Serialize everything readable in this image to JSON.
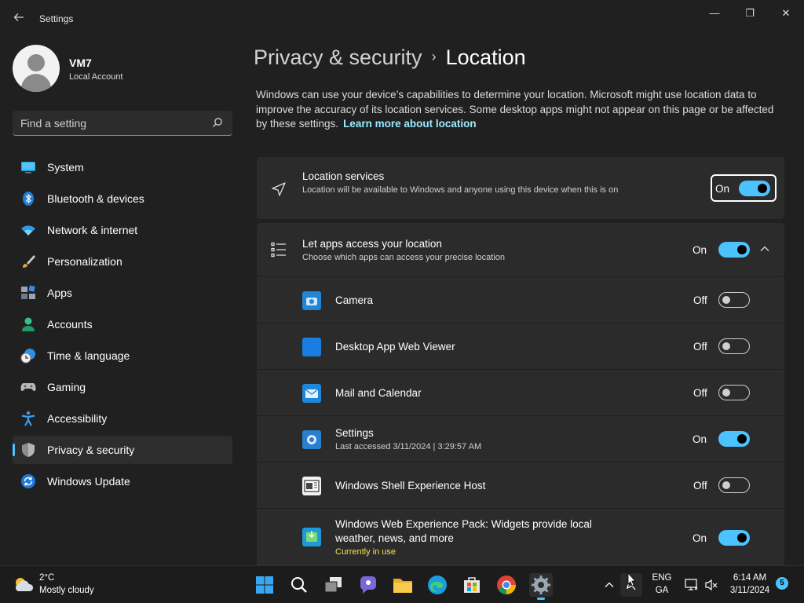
{
  "window": {
    "title": "Settings",
    "controls": {
      "minimize": "—",
      "maximize": "❐",
      "close": "✕"
    }
  },
  "profile": {
    "name": "VM7",
    "account_type": "Local Account"
  },
  "search": {
    "placeholder": "Find a setting"
  },
  "sidebar": {
    "items": [
      {
        "label": "System",
        "icon": "system-icon"
      },
      {
        "label": "Bluetooth & devices",
        "icon": "bluetooth-icon"
      },
      {
        "label": "Network & internet",
        "icon": "wifi-icon"
      },
      {
        "label": "Personalization",
        "icon": "brush-icon"
      },
      {
        "label": "Apps",
        "icon": "apps-icon"
      },
      {
        "label": "Accounts",
        "icon": "accounts-icon"
      },
      {
        "label": "Time & language",
        "icon": "clock-globe-icon"
      },
      {
        "label": "Gaming",
        "icon": "gamepad-icon"
      },
      {
        "label": "Accessibility",
        "icon": "accessibility-icon"
      },
      {
        "label": "Privacy & security",
        "icon": "shield-icon",
        "active": true
      },
      {
        "label": "Windows Update",
        "icon": "update-icon"
      }
    ]
  },
  "breadcrumb": {
    "parent": "Privacy & security",
    "separator": "›",
    "current": "Location"
  },
  "description": {
    "text": "Windows can use your device’s capabilities to determine your location. Microsoft might use location data to improve the accuracy of its location services. Some desktop apps might not appear on this page or be affected by these settings.",
    "link": "Learn more about location"
  },
  "location_services": {
    "title": "Location services",
    "subtitle": "Location will be available to Windows and anyone using this device when this is on",
    "state": "On"
  },
  "apps_access": {
    "title": "Let apps access your location",
    "subtitle": "Choose which apps can access your precise location",
    "state": "On"
  },
  "apps": [
    {
      "name": "Camera",
      "state": "Off",
      "meta": "",
      "status": ""
    },
    {
      "name": "Desktop App Web Viewer",
      "state": "Off",
      "meta": "",
      "status": ""
    },
    {
      "name": "Mail and Calendar",
      "state": "Off",
      "meta": "",
      "status": ""
    },
    {
      "name": "Settings",
      "state": "On",
      "meta": "Last accessed 3/11/2024  |  3:29:57 AM",
      "status": ""
    },
    {
      "name": "Windows Shell Experience Host",
      "state": "Off",
      "meta": "",
      "status": ""
    },
    {
      "name": "Windows Web Experience Pack: Widgets provide local weather, news, and more",
      "state": "On",
      "meta": "",
      "status": "Currently in use"
    }
  ],
  "taskbar": {
    "weather": {
      "temp": "2°C",
      "condition": "Mostly cloudy"
    },
    "language": {
      "line1": "ENG",
      "line2": "GA"
    },
    "clock": {
      "time": "6:14 AM",
      "date": "3/11/2024"
    },
    "notification_count": "5"
  },
  "colors": {
    "accent": "#4cc2ff",
    "background": "#202020",
    "card": "#2b2b2b",
    "link": "#99ebff",
    "in_use": "#f5e050"
  }
}
